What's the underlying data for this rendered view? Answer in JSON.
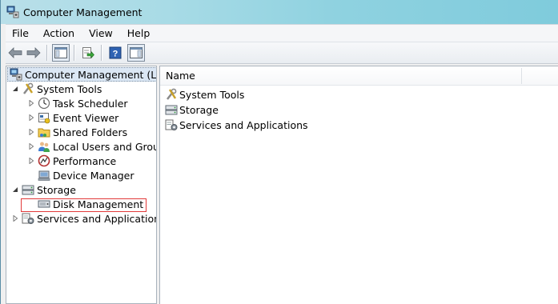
{
  "window": {
    "title": "Computer Management"
  },
  "menu": [
    "File",
    "Action",
    "View",
    "Help"
  ],
  "toolbar": {
    "buttons": [
      {
        "name": "back-button",
        "icon": "arrow-left-icon"
      },
      {
        "name": "forward-button",
        "icon": "arrow-right-icon"
      },
      {
        "name": "show-hide-console-tree-button",
        "icon": "console-tree-icon"
      },
      {
        "name": "export-list-button",
        "icon": "export-icon"
      },
      {
        "name": "help-button",
        "icon": "help-icon"
      },
      {
        "name": "show-hide-action-pane-button",
        "icon": "action-pane-icon"
      }
    ]
  },
  "tree": {
    "root": "Computer Management (Local",
    "items": [
      {
        "label": "System Tools"
      },
      {
        "label": "Task Scheduler"
      },
      {
        "label": "Event Viewer"
      },
      {
        "label": "Shared Folders"
      },
      {
        "label": "Local Users and Groups"
      },
      {
        "label": "Performance"
      },
      {
        "label": "Device Manager"
      },
      {
        "label": "Storage"
      },
      {
        "label": "Disk Management"
      },
      {
        "label": "Services and Applications"
      }
    ]
  },
  "list": {
    "column_name": "Name",
    "rows": [
      "System Tools",
      "Storage",
      "Services and Applications"
    ]
  }
}
